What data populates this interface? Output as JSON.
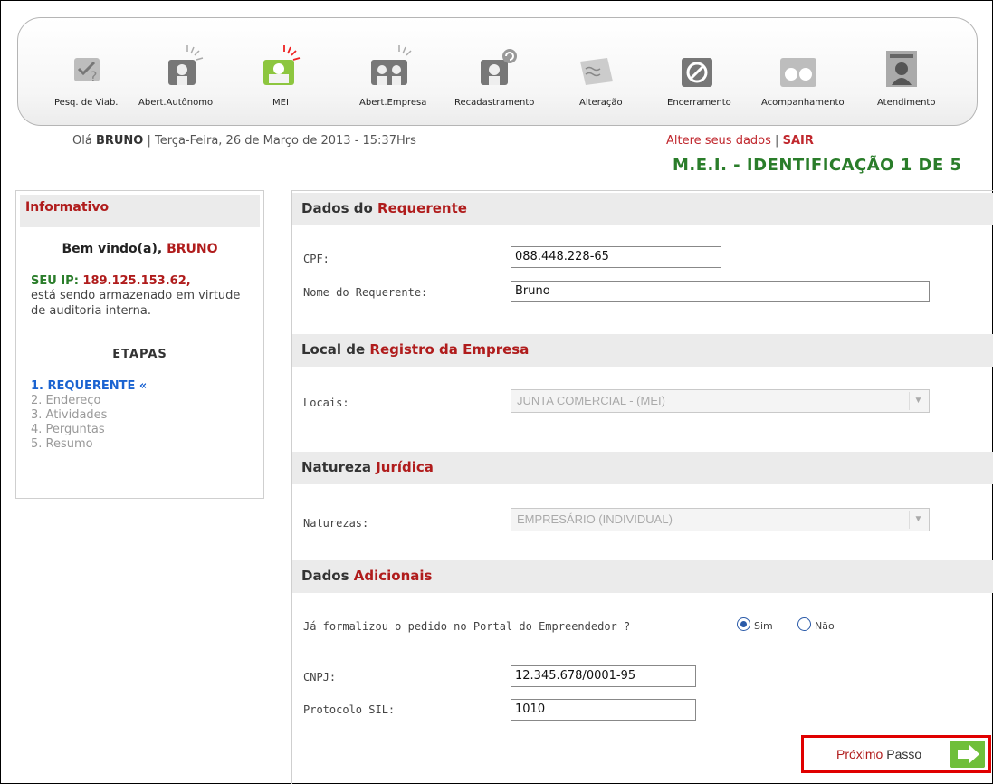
{
  "nav": {
    "items": [
      {
        "label": "Pesq. de Viab.",
        "icon": "search-viability-icon"
      },
      {
        "label": "Abert.Autônomo",
        "icon": "autonomous-person-icon"
      },
      {
        "label": "MEI",
        "icon": "mei-person-icon"
      },
      {
        "label": "Abert.Empresa",
        "icon": "company-people-icon"
      },
      {
        "label": "Recadastramento",
        "icon": "re-register-icon"
      },
      {
        "label": "Alteração",
        "icon": "document-edit-icon"
      },
      {
        "label": "Encerramento",
        "icon": "closure-icon"
      },
      {
        "label": "Acompanhamento",
        "icon": "binoculars-icon"
      },
      {
        "label": "Atendimento",
        "icon": "attendant-icon"
      }
    ]
  },
  "header": {
    "greeting_prefix": "Olá",
    "user": "BRUNO",
    "date_text": "| Terça-Feira, 26 de Março de 2013 - 15:37Hrs",
    "change_data": "Altere seus dados",
    "separator": "|",
    "logout": "SAIR",
    "title": "M.E.I. - IDENTIFICAÇÃO 1 DE 5"
  },
  "sidebar": {
    "title": "Informativo",
    "welcome_prefix": "Bem vindo(a),",
    "welcome_name": "BRUNO",
    "ip_label": "SEU IP:",
    "ip_value": "189.125.153.62,",
    "ip_text": "está sendo armazenado em virtude de auditoria interna.",
    "steps_title": "ETAPAS",
    "steps": [
      "1. REQUERENTE «",
      "2. Endereço",
      "3. Atividades",
      "4. Perguntas",
      "5. Resumo"
    ]
  },
  "form": {
    "requerente": {
      "head_a": "Dados do",
      "head_b": "Requerente",
      "cpf_label": "CPF:",
      "cpf_value": "088.448.228-65",
      "nome_label": "Nome do Requerente:",
      "nome_value": "Bruno"
    },
    "local": {
      "head_a": "Local de",
      "head_b": "Registro da Empresa",
      "label": "Locais:",
      "value": "JUNTA COMERCIAL - (MEI)"
    },
    "natureza": {
      "head_a": "Natureza",
      "head_b": "Jurídica",
      "label": "Naturezas:",
      "value": "EMPRESÁRIO (INDIVIDUAL)"
    },
    "adicionais": {
      "head_a": "Dados",
      "head_b": "Adicionais",
      "question": "Já formalizou o pedido no Portal do Empreendedor ?",
      "opt_yes": "Sim",
      "opt_no": "Não",
      "selected": "Sim",
      "cnpj_label": "CNPJ:",
      "cnpj_value": "12.345.678/0001-95",
      "protocolo_label": "Protocolo SIL:",
      "protocolo_value": "1010"
    }
  },
  "next": {
    "part_a": "Próximo",
    "part_b": "Passo"
  },
  "colors": {
    "accent_red": "#b01c1c",
    "title_green": "#2a7d2a",
    "active_step": "#1a63d1",
    "highlight_border": "#e00000"
  }
}
